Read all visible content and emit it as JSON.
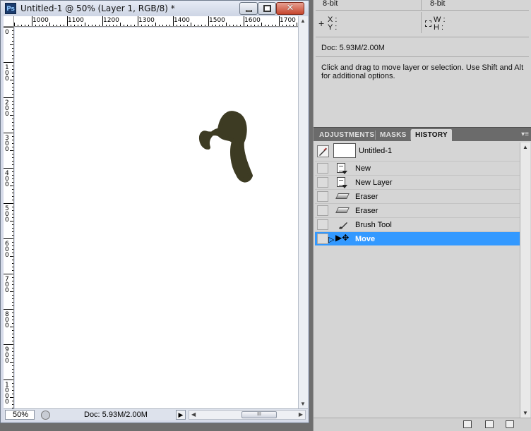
{
  "document_window": {
    "app_icon": "Ps",
    "title": "Untitled-1 @ 50% (Layer 1, RGB/8) *",
    "buttons": {
      "minimize": "minimize-icon",
      "maximize": "maximize-icon",
      "close_glyph": "✕"
    },
    "ruler": {
      "h_labels": [
        "1000",
        "1100",
        "1200",
        "1300",
        "1400",
        "1500",
        "1600",
        "1700"
      ],
      "v_labels": [
        "0",
        "100",
        "200",
        "300",
        "400",
        "500",
        "600",
        "700",
        "800",
        "900",
        "1000"
      ]
    },
    "stroke_color": "#3d3b23",
    "status": {
      "zoom": "50%",
      "doc_size": "Doc: 5.93M/2.00M",
      "arrow": "▶",
      "scroll_thumb": "III"
    }
  },
  "info_panel": {
    "bit_left": "8-bit",
    "bit_right": "8-bit",
    "x_label": "X :",
    "y_label": "Y :",
    "w_label": "W :",
    "h_label": "H :",
    "doc_size": "Doc: 5.93M/2.00M",
    "hint_line1": "Click and drag to move layer or selection.  Use Shift and Alt",
    "hint_line2": "for additional options."
  },
  "panel_tabs": {
    "tabs": [
      "ADJUSTMENTS",
      "MASKS",
      "HISTORY"
    ],
    "active": "HISTORY",
    "menu_glyph": "▾≡"
  },
  "history": {
    "snapshot_label": "Untitled-1",
    "steps": [
      {
        "label": "New",
        "icon": "document-icon",
        "selected": false
      },
      {
        "label": "New Layer",
        "icon": "document-icon",
        "selected": false
      },
      {
        "label": "Eraser",
        "icon": "eraser-icon",
        "selected": false
      },
      {
        "label": "Eraser",
        "icon": "eraser-icon",
        "selected": false
      },
      {
        "label": "Brush Tool",
        "icon": "brush-icon",
        "selected": false
      },
      {
        "label": "Move",
        "icon": "move-icon",
        "selected": true
      }
    ],
    "selected_color": "#3399ff"
  }
}
